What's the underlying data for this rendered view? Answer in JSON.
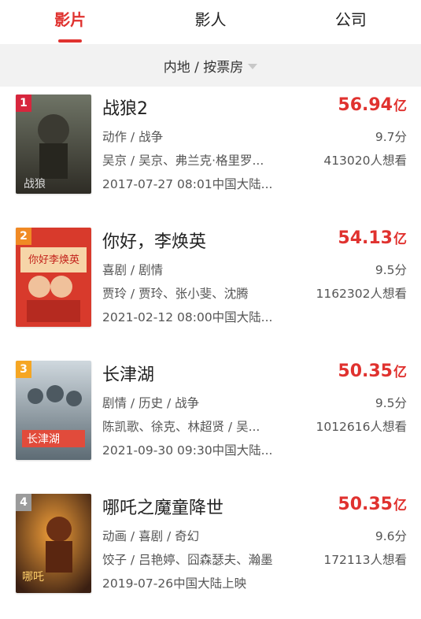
{
  "tabs": [
    "影片",
    "影人",
    "公司"
  ],
  "filter": {
    "label": "内地 / 按票房"
  },
  "movies": [
    {
      "rank": "1",
      "title": "战狼2",
      "box": "56.94",
      "box_unit": "亿",
      "genre": "动作 / 战争",
      "score": "9.7分",
      "cast": "吴京 / 吴京、弗兰克·格里罗...",
      "want": "413020人想看",
      "release": "2017-07-27 08:01中国大陆...",
      "rank_color": "#d7263d"
    },
    {
      "rank": "2",
      "title": "你好，李焕英",
      "box": "54.13",
      "box_unit": "亿",
      "genre": "喜剧 / 剧情",
      "score": "9.5分",
      "cast": "贾玲 / 贾玲、张小斐、沈腾",
      "want": "1162302人想看",
      "release": "2021-02-12 08:00中国大陆...",
      "rank_color": "#f08a24"
    },
    {
      "rank": "3",
      "title": "长津湖",
      "box": "50.35",
      "box_unit": "亿",
      "genre": "剧情 / 历史 / 战争",
      "score": "9.5分",
      "cast": "陈凯歌、徐克、林超贤 / 吴...",
      "want": "1012616人想看",
      "release": "2021-09-30 09:30中国大陆...",
      "rank_color": "#f5a623"
    },
    {
      "rank": "4",
      "title": "哪吒之魔童降世",
      "box": "50.35",
      "box_unit": "亿",
      "genre": "动画 / 喜剧 / 奇幻",
      "score": "9.6分",
      "cast": "饺子 / 吕艳婷、囧森瑟夫、瀚墨",
      "want": "172113人想看",
      "release": "2019-07-26中国大陆上映",
      "rank_color": "#9b9b9b"
    }
  ]
}
